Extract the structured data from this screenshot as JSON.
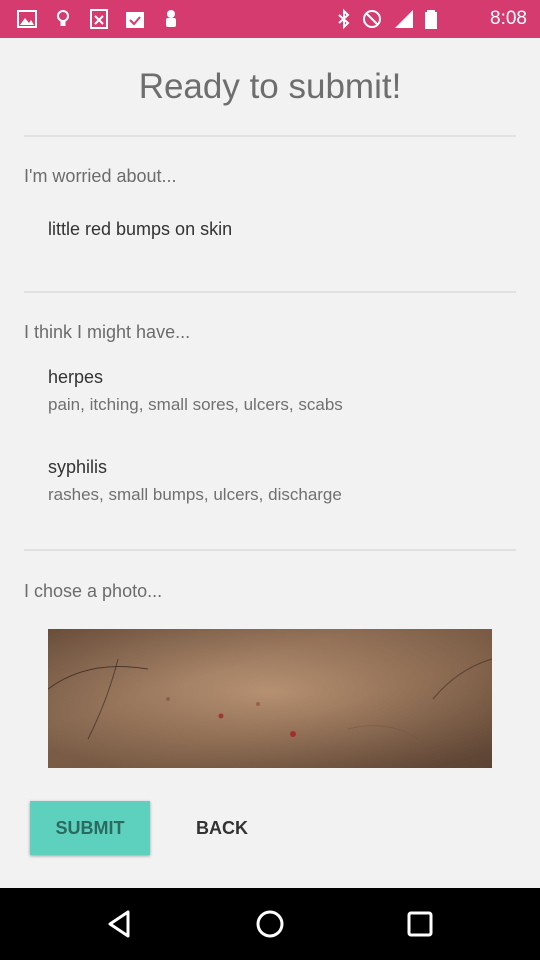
{
  "status_bar": {
    "time": "8:08",
    "notification_icons": [
      "gallery-icon",
      "bulb-icon",
      "calculator-icon",
      "calendar-check-icon",
      "robot-icon"
    ],
    "system_icons": [
      "bluetooth-icon",
      "do-not-disturb-icon",
      "signal-icon",
      "battery-icon"
    ]
  },
  "page": {
    "title": "Ready to submit!"
  },
  "worried": {
    "label": "I'm worried about...",
    "value": "little red bumps on skin"
  },
  "might_have": {
    "label": "I think I might have...",
    "conditions": [
      {
        "name": "herpes",
        "symptoms": "pain, itching, small sores, ulcers, scabs"
      },
      {
        "name": "syphilis",
        "symptoms": "rashes, small bumps, ulcers, discharge"
      }
    ]
  },
  "photo": {
    "label": "I chose a photo..."
  },
  "actions": {
    "submit_label": "SUBMIT",
    "back_label": "BACK"
  },
  "colors": {
    "status_bar": "#d63b6f",
    "submit_button": "#5dd1bd",
    "background": "#f2f2f2"
  },
  "nav_bar": {
    "buttons": [
      "back-triangle-icon",
      "home-circle-icon",
      "recents-square-icon"
    ]
  }
}
